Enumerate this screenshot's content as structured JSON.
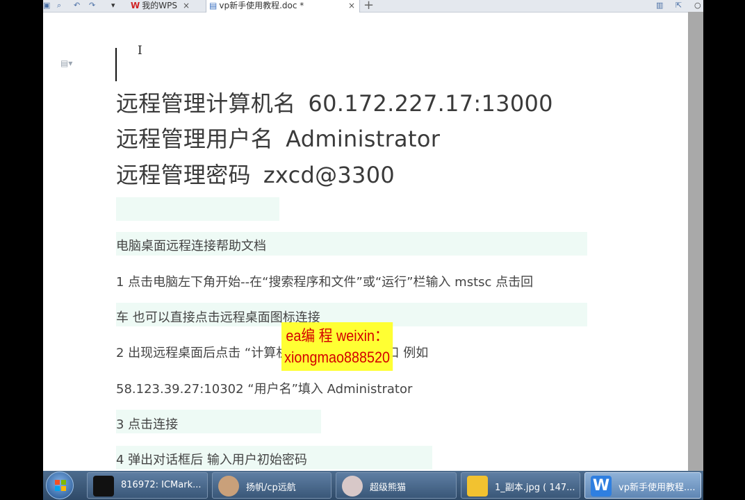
{
  "toolbar": {
    "tabs": [
      {
        "label": "我的WPS",
        "close": "×"
      },
      {
        "label": "vp新手使用教程.doc *",
        "close": "×"
      }
    ],
    "new_tab": "+"
  },
  "document": {
    "credentials": [
      {
        "label": "远程管理计算机名",
        "value": "60.172.227.17:13000"
      },
      {
        "label": "远程管理用户名",
        "value": "Administrator"
      },
      {
        "label": "远程管理密码",
        "value": "zxcd@3300"
      }
    ],
    "paragraphs": [
      "电脑桌面远程连接帮助文档",
      "1 点击电脑左下角开始--在“搜索程序和文件”或“运行”栏输入 mstsc 点击回",
      "车 也可以直接点击远程桌面图标连接",
      "2 出现远程桌面后点击 “计算机(C)” 输入 IP 及端口 例如",
      "58.123.39.27:10302 “用户名”填入 Administrator",
      "3 点击连接",
      "4 弹出对话框后 输入用户初始密码"
    ]
  },
  "overlay": {
    "line1": "ea编 程 weixin：",
    "line2": "xiongmao888520"
  },
  "taskbar": {
    "items": [
      {
        "label": "816972: ICMark...",
        "icon": "chart-app-icon",
        "color": "#111111"
      },
      {
        "label": "扬帆/cp远航",
        "icon": "avatar-icon",
        "color": "#c9a07a"
      },
      {
        "label": "超级熊猫",
        "icon": "panda-icon",
        "color": "#d8c8c8"
      },
      {
        "label": "1_副本.jpg ( 147...",
        "icon": "image-viewer-icon",
        "color": "#f2c230"
      },
      {
        "label": "vp新手使用教程....",
        "icon": "wps-writer-icon",
        "color": "#2f7fe0"
      }
    ]
  },
  "colors": {
    "accent": "#2f7fe0",
    "overlay_bg": "#ffff33",
    "overlay_text": "#d40000"
  }
}
